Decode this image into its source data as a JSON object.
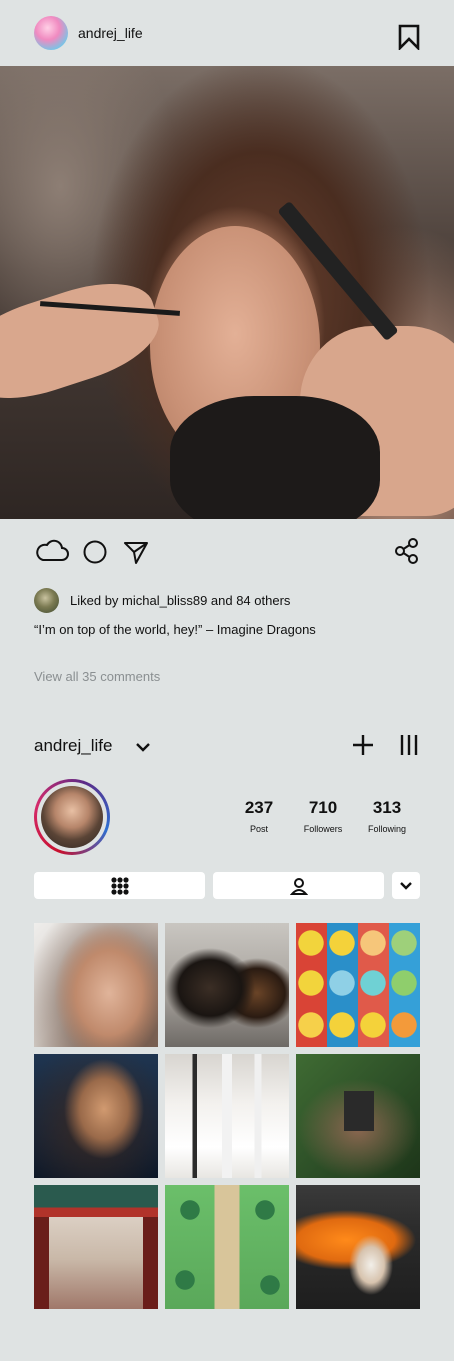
{
  "post": {
    "username": "andrej_life",
    "likes_text": "Liked by michal_bliss89 and 84 others",
    "caption": "“I’m on top of the world, hey!” – Imagine Dragons",
    "view_comments": "View all 35 comments"
  },
  "profile": {
    "username": "andrej_life",
    "stats": [
      {
        "value": "237",
        "label": "Post"
      },
      {
        "value": "710",
        "label": "Followers"
      },
      {
        "value": "313",
        "label": "Following"
      }
    ]
  },
  "icons": {
    "bookmark": "bookmark-icon",
    "like": "cloud-icon",
    "comment": "circle-icon",
    "send": "send-icon",
    "share": "share-icon",
    "add": "plus-icon",
    "menu": "menu-icon",
    "grid": "grid-icon",
    "tagged": "person-icon",
    "dropdown": "chevron-down-icon"
  },
  "colors": {
    "background": "#dfe3e3",
    "muted_text": "#8a8f91",
    "story_ring": "#c8102e"
  }
}
